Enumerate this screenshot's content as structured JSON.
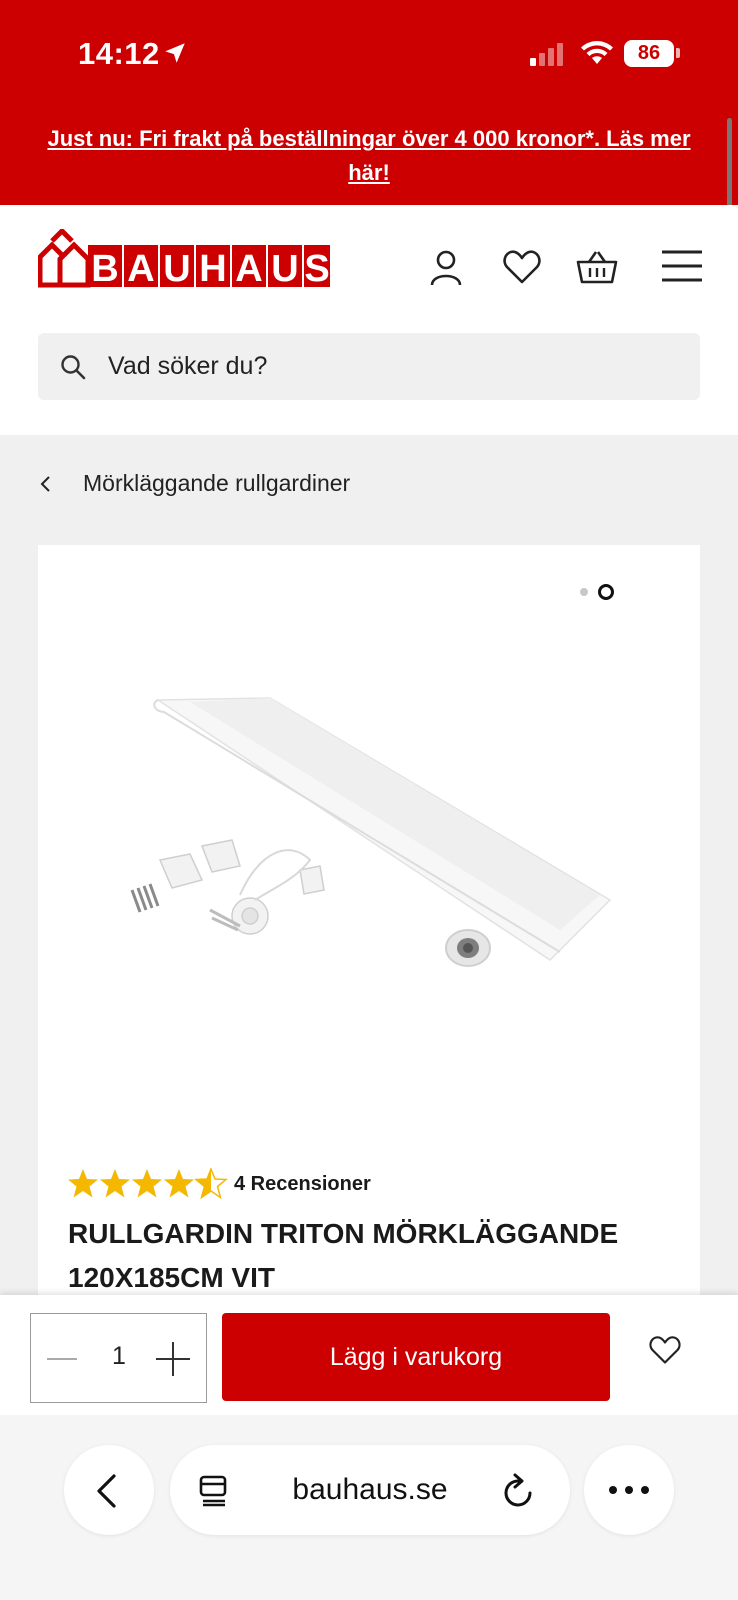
{
  "status_bar": {
    "time": "14:12",
    "battery": "86"
  },
  "promo": {
    "text": "Just nu: Fri frakt på beställningar över 4 000 kronor*. Läs mer här!"
  },
  "header": {
    "logo_text": "BAUHAUS",
    "icons": [
      "user-icon",
      "heart-icon",
      "basket-icon",
      "menu-icon"
    ]
  },
  "search": {
    "placeholder": "Vad söker du?"
  },
  "breadcrumb": {
    "label": "Mörkläggande rullgardiner"
  },
  "product": {
    "image_count": 2,
    "active_image": 2,
    "rating": 4.5,
    "rating_max": 5,
    "reviews_label": "4 Recensioner",
    "title": "RULLGARDIN TRITON MÖRKLÄGGANDE 120X185CM VIT"
  },
  "cart": {
    "quantity": "1",
    "add_label": "Lägg i varukorg"
  },
  "browser": {
    "url": "bauhaus.se"
  },
  "colors": {
    "brand_red": "#cc0000",
    "page_gray": "#f0f0f0"
  }
}
